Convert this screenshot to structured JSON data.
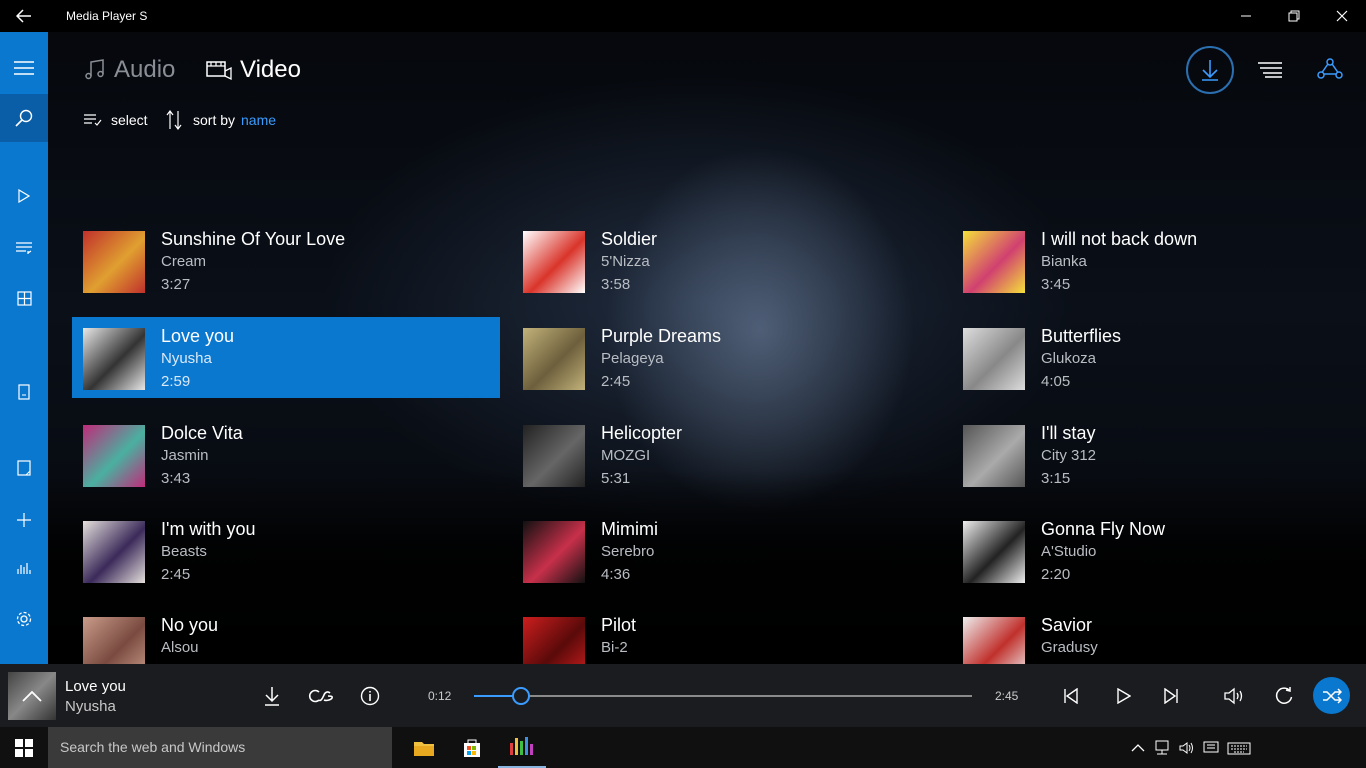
{
  "app": {
    "title": "Media Player S"
  },
  "tabs": [
    {
      "label": "Audio",
      "icon": "music-note-icon",
      "active": false
    },
    {
      "label": "Video",
      "icon": "film-icon",
      "active": true
    }
  ],
  "toolbar": {
    "select_label": "select",
    "sort_label": "sort by",
    "sort_value": "name"
  },
  "tracks": [
    {
      "title": "Sunshine Of Your Love",
      "artist": "Cream",
      "duration": "3:27",
      "art_colors": [
        "#c0302c",
        "#e0a030"
      ]
    },
    {
      "title": "Soldier",
      "artist": "5'Nizza",
      "duration": "3:58",
      "art_colors": [
        "#ffffff",
        "#d9342a"
      ]
    },
    {
      "title": "I will not back down",
      "artist": "Bianka",
      "duration": "3:45",
      "art_colors": [
        "#f4e03a",
        "#d04070"
      ]
    },
    {
      "title": "Love you",
      "artist": "Nyusha",
      "duration": "2:59",
      "art_colors": [
        "#e8e8e8",
        "#333333"
      ],
      "selected": true
    },
    {
      "title": "Purple Dreams",
      "artist": "Pelageya",
      "duration": "2:45",
      "art_colors": [
        "#c2b27a",
        "#6d5f3c"
      ]
    },
    {
      "title": "Butterflies",
      "artist": "Glukoza",
      "duration": "4:05",
      "art_colors": [
        "#dddddd",
        "#888888"
      ]
    },
    {
      "title": "Dolce Vita",
      "artist": "Jasmin",
      "duration": "3:43",
      "art_colors": [
        "#c02b7a",
        "#4ab0a0"
      ]
    },
    {
      "title": "Helicopter",
      "artist": "MOZGI",
      "duration": "5:31",
      "art_colors": [
        "#222222",
        "#666666"
      ]
    },
    {
      "title": "I'll stay",
      "artist": "City 312",
      "duration": "3:15",
      "art_colors": [
        "#555555",
        "#aaaaaa"
      ]
    },
    {
      "title": "I'm with you",
      "artist": "Beasts",
      "duration": "2:45",
      "art_colors": [
        "#e5e0dc",
        "#3b2a5a"
      ]
    },
    {
      "title": "Mimimi",
      "artist": "Serebro",
      "duration": "4:36",
      "art_colors": [
        "#111111",
        "#c8304a"
      ]
    },
    {
      "title": "Gonna Fly Now",
      "artist": "A'Studio",
      "duration": "2:20",
      "art_colors": [
        "#eeeeee",
        "#222222"
      ]
    },
    {
      "title": "No you",
      "artist": "Alsou",
      "duration": "",
      "art_colors": [
        "#c89c8a",
        "#7a4a40"
      ]
    },
    {
      "title": "Pilot",
      "artist": "Bi-2",
      "duration": "",
      "art_colors": [
        "#cc1e1e",
        "#5a0a0a"
      ]
    },
    {
      "title": "Savior",
      "artist": "Gradusy",
      "duration": "",
      "art_colors": [
        "#eeeeee",
        "#c0302c"
      ]
    }
  ],
  "player": {
    "title": "Love you",
    "artist": "Nyusha",
    "current_time": "0:12",
    "total_time": "2:45",
    "progress": 0.094
  },
  "taskbar": {
    "search_placeholder": "Search the web and Windows"
  },
  "colors": {
    "accent": "#0b78d0",
    "link": "#3b9cff"
  }
}
